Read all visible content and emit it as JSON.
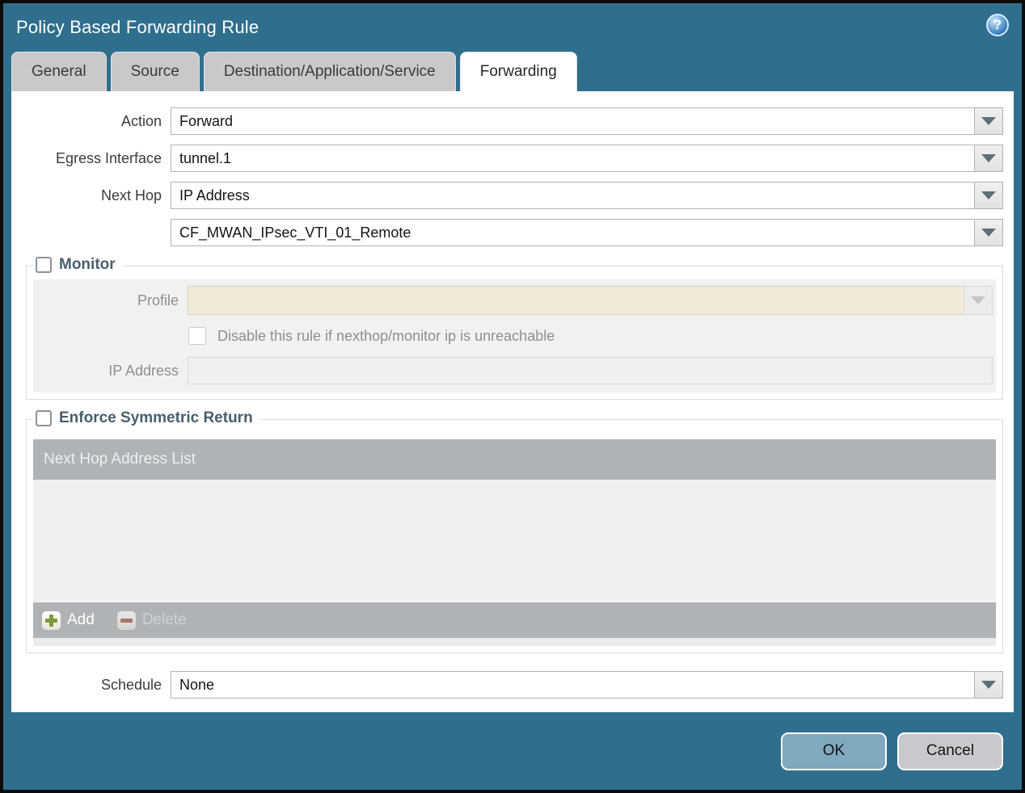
{
  "dialog": {
    "title": "Policy Based Forwarding Rule",
    "help_glyph": "?"
  },
  "tabs": [
    {
      "label": "General",
      "active": false
    },
    {
      "label": "Source",
      "active": false
    },
    {
      "label": "Destination/Application/Service",
      "active": false
    },
    {
      "label": "Forwarding",
      "active": true
    }
  ],
  "form": {
    "action": {
      "label": "Action",
      "value": "Forward"
    },
    "egress_interface": {
      "label": "Egress Interface",
      "value": "tunnel.1"
    },
    "next_hop": {
      "label": "Next Hop",
      "value": "IP Address"
    },
    "next_hop_value": {
      "value": "CF_MWAN_IPsec_VTI_01_Remote"
    },
    "schedule": {
      "label": "Schedule",
      "value": "None"
    }
  },
  "monitor": {
    "legend": "Monitor",
    "checked": false,
    "profile": {
      "label": "Profile",
      "value": ""
    },
    "disable_rule": {
      "label": "Disable this rule if nexthop/monitor ip is unreachable",
      "checked": false
    },
    "ip_address": {
      "label": "IP Address",
      "value": ""
    }
  },
  "symmetric_return": {
    "legend": "Enforce Symmetric Return",
    "checked": false,
    "table": {
      "header": "Next Hop Address List",
      "rows": [],
      "add_label": "Add",
      "delete_label": "Delete"
    }
  },
  "footer": {
    "ok_label": "OK",
    "cancel_label": "Cancel"
  },
  "colors": {
    "titlebar_teal": "#306E8D",
    "tab_gray": "#C9C9C9",
    "table_header_gray": "#AFB3B6",
    "profile_field_beige": "#F0EAD9",
    "ok_button_blue": "#7FA9BE",
    "cancel_button_gray": "#C9C9CD",
    "add_icon_green": "#7F9A3A",
    "delete_icon_red": "#AA7468"
  }
}
